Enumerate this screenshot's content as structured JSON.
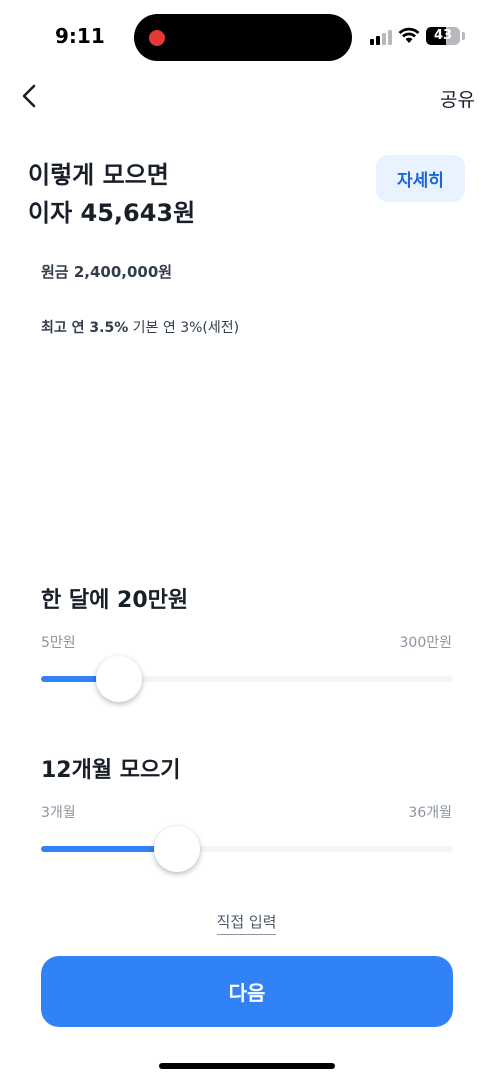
{
  "status_bar": {
    "time": "9:11",
    "battery_level": "43"
  },
  "nav": {
    "share_label": "공유"
  },
  "summary": {
    "headline_line1": "이렇게 모으면",
    "headline_line2": "이자 45,643원",
    "detail_label": "자세히",
    "principal": "원금 2,400,000원",
    "rate_max": "최고 연 3.5%",
    "rate_base": "기본 연 3%(세전)"
  },
  "monthly_slider": {
    "title": "한 달에 20만원",
    "min_label": "5만원",
    "max_label": "300만원",
    "fraction": 0.15
  },
  "period_slider": {
    "title": "12개월 모으기",
    "min_label": "3개월",
    "max_label": "36개월",
    "fraction": 0.31
  },
  "direct_input_label": "직접 입력",
  "next_label": "다음",
  "colors": {
    "accent": "#3182f6",
    "detail_bg": "#e8f3ff",
    "detail_text": "#1b64da"
  }
}
